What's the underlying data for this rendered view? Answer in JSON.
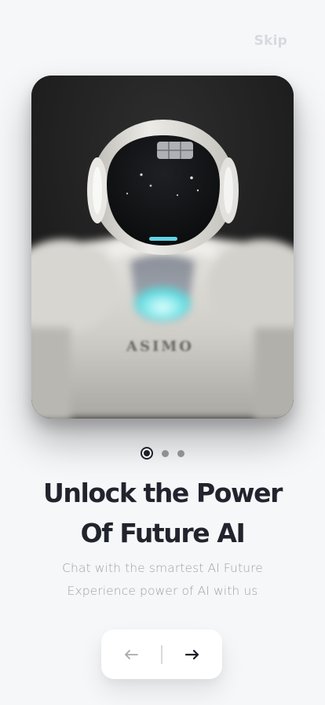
{
  "header": {
    "skip_label": "Skip"
  },
  "hero": {
    "robot_badge_text": "ASIMO"
  },
  "pagination": {
    "total": 3,
    "active_index": 0
  },
  "content": {
    "headline_line1": "Unlock the Power",
    "headline_line2": "Of  Future AI",
    "subtitle_line1": "Chat with the smartest AI Future",
    "subtitle_line2": "Experience power of AI with us"
  },
  "navigation": {
    "back_icon": "arrow-left-icon",
    "next_icon": "arrow-right-icon"
  },
  "colors": {
    "background": "#f6f7f9",
    "headline": "#22242d",
    "subtitle": "#9fa2a9",
    "skip": "#d7d9de",
    "dot_inactive": "#8e9096",
    "dot_active": "#1f2028",
    "accent_glow": "#7fe7ea"
  }
}
